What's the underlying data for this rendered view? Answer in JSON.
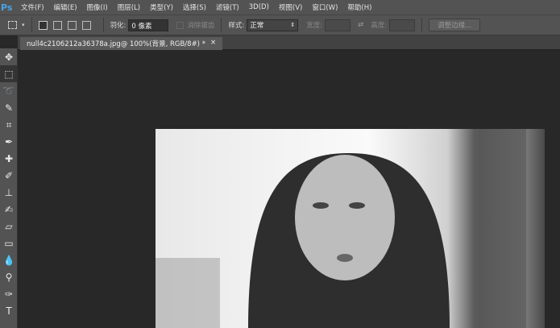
{
  "app": {
    "logo": "Ps"
  },
  "menu": [
    "文件(F)",
    "编辑(E)",
    "图像(I)",
    "图层(L)",
    "类型(Y)",
    "选择(S)",
    "滤镜(T)",
    "3D(D)",
    "视图(V)",
    "窗口(W)",
    "帮助(H)"
  ],
  "options": {
    "feather_label": "羽化:",
    "feather_value": "0 像素",
    "antialias_label": "消除锯齿",
    "style_label": "样式:",
    "style_value": "正常",
    "width_label": "宽度:",
    "height_label": "高度:",
    "refine_edge": "调整边缘..."
  },
  "document_tab": {
    "title": "null4c2106212a36378a.jpg@ 100%(背景, RGB/8#) *",
    "close": "×"
  },
  "tools": [
    {
      "name": "move-tool-icon",
      "glyph": "✥"
    },
    {
      "name": "marquee-tool-icon",
      "glyph": "⬚"
    },
    {
      "name": "lasso-tool-icon",
      "glyph": "➰"
    },
    {
      "name": "quick-select-tool-icon",
      "glyph": "✎"
    },
    {
      "name": "crop-tool-icon",
      "glyph": "⌗"
    },
    {
      "name": "eyedropper-tool-icon",
      "glyph": "✒"
    },
    {
      "name": "healing-tool-icon",
      "glyph": "✚"
    },
    {
      "name": "brush-tool-icon",
      "glyph": "✐"
    },
    {
      "name": "stamp-tool-icon",
      "glyph": "⊥"
    },
    {
      "name": "history-brush-icon",
      "glyph": "✍"
    },
    {
      "name": "eraser-tool-icon",
      "glyph": "▱"
    },
    {
      "name": "gradient-tool-icon",
      "glyph": "▭"
    },
    {
      "name": "blur-tool-icon",
      "glyph": "💧"
    },
    {
      "name": "dodge-tool-icon",
      "glyph": "⚲"
    },
    {
      "name": "pen-tool-icon",
      "glyph": "✑"
    },
    {
      "name": "type-tool-icon",
      "glyph": "T"
    }
  ]
}
